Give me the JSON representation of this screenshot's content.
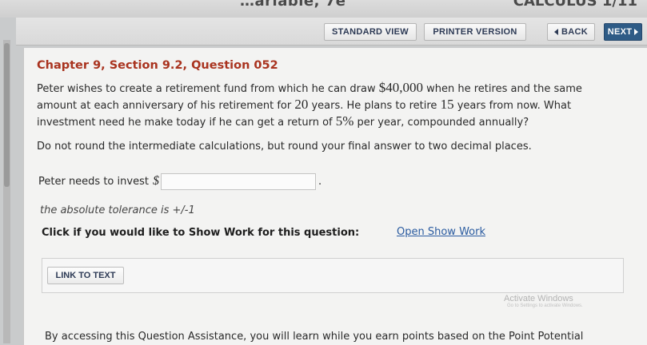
{
  "header": {
    "title_fragment": "…ariable, 7e",
    "right_fragment": "CALCULUS 1/11"
  },
  "toolbar": {
    "standard_view": "STANDARD VIEW",
    "printer_version": "PRINTER VERSION",
    "back": "BACK",
    "next": "NEXT"
  },
  "question": {
    "title": "Chapter 9, Section 9.2, Question 052",
    "line1_a": "Peter wishes to create a retirement fund from which he can draw ",
    "amount": "$40,000",
    "line1_b": " when he retires and the same",
    "line2_a": "amount at each anniversary of his retirement for ",
    "years": "20",
    "line2_b": " years. He plans to retire ",
    "retire_in": "15",
    "line2_c": " years from now. What",
    "line3_a": "investment need he make today if he can get a return of ",
    "rate": "5%",
    "line3_b": " per year, compounded annually?",
    "instructions": "Do not round the intermediate calculations, but round your final answer to two decimal places."
  },
  "answer": {
    "label": "Peter needs to invest",
    "currency": "$",
    "value": "",
    "suffix": ".",
    "tolerance": "the absolute tolerance is +/-1"
  },
  "show_work": {
    "prompt": "Click if you would like to Show Work for this question:",
    "link": "Open Show Work"
  },
  "link_to_text": "LINK TO TEXT",
  "watermark": {
    "line1": "Activate Windows",
    "line2": "Go to Settings to activate Windows."
  },
  "footer": {
    "text": "By accessing this Question Assistance, you will learn while you earn points based on the Point Potential"
  }
}
